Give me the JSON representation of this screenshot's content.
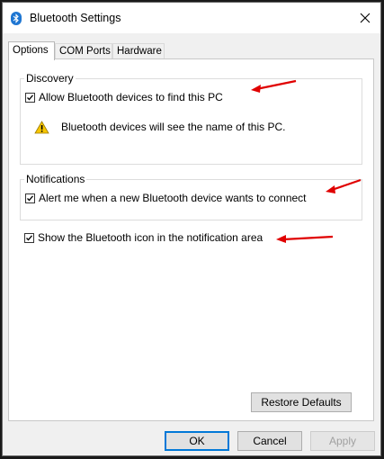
{
  "window": {
    "title": "Bluetooth Settings",
    "title_icon": "bluetooth-icon",
    "close_icon": "close-icon"
  },
  "tabs": [
    {
      "label": "Options",
      "active": true
    },
    {
      "label": "COM Ports",
      "active": false
    },
    {
      "label": "Hardware",
      "active": false
    }
  ],
  "discovery": {
    "group_label": "Discovery",
    "allow_checkbox": {
      "label": "Allow Bluetooth devices to find this PC",
      "checked": true
    },
    "warning": {
      "icon": "warning-icon",
      "text": "Bluetooth devices will see the name of this PC."
    }
  },
  "notifications": {
    "group_label": "Notifications",
    "alert_checkbox": {
      "label": "Alert me when a new Bluetooth device wants to connect",
      "checked": true
    }
  },
  "show_icon_checkbox": {
    "label": "Show the Bluetooth icon in the notification area",
    "checked": true
  },
  "buttons": {
    "restore_defaults": "Restore Defaults",
    "ok": "OK",
    "cancel": "Cancel",
    "apply": "Apply"
  },
  "colors": {
    "annotation_arrow": "#e00000",
    "accent": "#0078d7",
    "bluetooth_icon": "#1e76d2"
  }
}
